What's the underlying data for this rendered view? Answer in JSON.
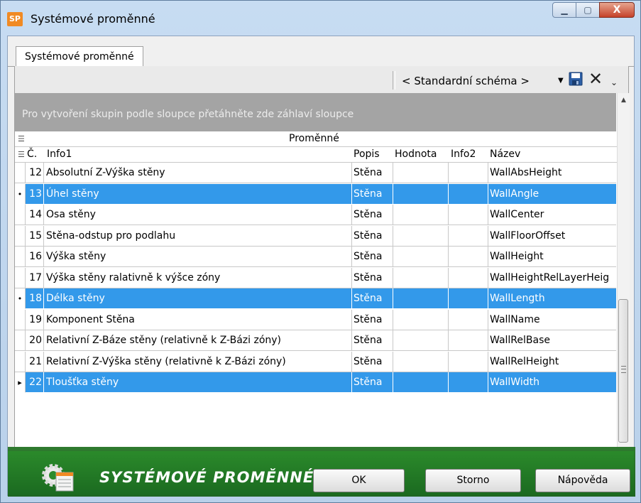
{
  "window": {
    "title": "Systémové proměnné",
    "app_icon_text": "SP",
    "minimize": "▁",
    "maximize": "▢",
    "close": "X"
  },
  "tab": {
    "label": "Systémové proměnné"
  },
  "toolbar": {
    "scheme_value": "< Standardní schéma >",
    "scheme_arrow": "▼",
    "close_glyph": "✕",
    "more_glyph": "⌄",
    "save_icon_color": "#1f4e8c"
  },
  "group_area": {
    "text": "Pro vytvoření skupin podle sloupce přetáhněte zde záhlaví sloupce"
  },
  "band": {
    "label": "Proměnné",
    "icon": "☰"
  },
  "columns": {
    "icon": "☰",
    "num": "Č.",
    "info1": "Info1",
    "popis": "Popis",
    "hodnota": "Hodnota",
    "info2": "Info2",
    "nazev": "Název"
  },
  "rows": [
    {
      "indicator": "",
      "num": "12",
      "info1": "Absolutní Z-Výška stěny",
      "popis": "Stěna",
      "hodnota": "",
      "info2": "",
      "nazev": "WallAbsHeight"
    },
    {
      "indicator": "•",
      "num": "13",
      "info1": "Úhel stěny",
      "popis": "Stěna",
      "hodnota": "",
      "info2": "",
      "nazev": "WallAngle"
    },
    {
      "indicator": "",
      "num": "14",
      "info1": "Osa stěny",
      "popis": "Stěna",
      "hodnota": "",
      "info2": "",
      "nazev": "WallCenter"
    },
    {
      "indicator": "",
      "num": "15",
      "info1": "Stěna-odstup pro podlahu",
      "popis": "Stěna",
      "hodnota": "",
      "info2": "",
      "nazev": "WallFloorOffset"
    },
    {
      "indicator": "",
      "num": "16",
      "info1": "Výška stěny",
      "popis": "Stěna",
      "hodnota": "",
      "info2": "",
      "nazev": "WallHeight"
    },
    {
      "indicator": "",
      "num": "17",
      "info1": "Výška stěny ralativně k výšce zóny",
      "popis": "Stěna",
      "hodnota": "",
      "info2": "",
      "nazev": "WallHeightRelLayerHeig"
    },
    {
      "indicator": "•",
      "num": "18",
      "info1": "Délka stěny",
      "popis": "Stěna",
      "hodnota": "",
      "info2": "",
      "nazev": "WallLength"
    },
    {
      "indicator": "",
      "num": "19",
      "info1": "Komponent Stěna",
      "popis": "Stěna",
      "hodnota": "",
      "info2": "",
      "nazev": "WallName"
    },
    {
      "indicator": "",
      "num": "20",
      "info1": "Relativní Z-Báze stěny (relativně k Z-Bázi zóny)",
      "popis": "Stěna",
      "hodnota": "",
      "info2": "",
      "nazev": "WallRelBase"
    },
    {
      "indicator": "",
      "num": "21",
      "info1": "Relativní Z-Výška stěny (relativně k Z-Bázi zóny)",
      "popis": "Stěna",
      "hodnota": "",
      "info2": "",
      "nazev": "WallRelHeight"
    },
    {
      "indicator": "▸",
      "num": "22",
      "info1": "Tloušťka stěny",
      "popis": "Stěna",
      "hodnota": "",
      "info2": "",
      "nazev": "WallWidth"
    }
  ],
  "selected_rows": [
    1,
    6,
    10
  ],
  "scroll": {
    "up": "▲",
    "down": "▼"
  },
  "footer": {
    "title": "SYSTÉMOVÉ PROMĚNNÉ",
    "ok": "OK",
    "storno": "Storno",
    "help": "Nápověda"
  },
  "colors": {
    "selection": "#3399ea",
    "footer": "#2b8a2b",
    "group_area": "#a4a4a4"
  }
}
